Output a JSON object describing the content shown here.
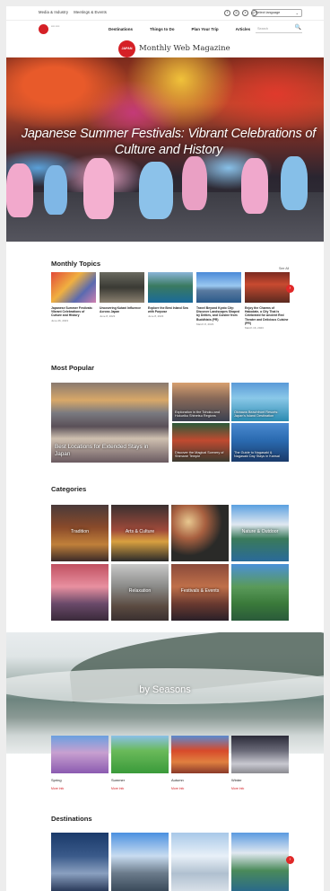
{
  "utility_bar": {
    "links": [
      "Media & Industry",
      "Meetings & Events"
    ],
    "social_icons": [
      "facebook-icon",
      "instagram-icon",
      "x-icon",
      "pinterest-icon"
    ],
    "language_select": "Select language",
    "language_caret": "⌄"
  },
  "nav": {
    "items": [
      "Destinations",
      "Things to Do",
      "Plan Your Trip",
      "Articles"
    ],
    "search_placeholder": "Search",
    "search_icon": "🔍"
  },
  "brand": {
    "mark": "JAPAN",
    "name": "Monthly Web Magazine"
  },
  "hero": {
    "title": "Japanese Summer Festivals: Vibrant Celebrations of Culture and History"
  },
  "monthly_topics": {
    "heading": "Monthly Topics",
    "see_all": "See All",
    "cards": [
      {
        "caption": "Japanese Summer Festivals: Vibrant Celebrations of Culture and History",
        "date": "June 26, 2023"
      },
      {
        "caption": "Uncovering Kutani Influence Across Japan",
        "date": "June 8, 2023"
      },
      {
        "caption": "Explore the Best Inland Sea with Purpose",
        "date": "June 8, 2023"
      },
      {
        "caption": "Travel Beyond Kyoto City: Discover Landscapes Shaped by Deities, and Cuisine from Buddhists (PR)",
        "date": "March 8, 2023"
      },
      {
        "caption": "Enjoy the Charms of Hakodate, a City That is Celebrated for Ancient Red Theater and Delicious Cuisine (PR)",
        "date": "March 16, 2023"
      }
    ]
  },
  "most_popular": {
    "heading": "Most Popular",
    "big": "Best Locations for Extended Stays in Japan",
    "small": [
      "Exploration in the Tohoku and Hokuriku Shinetsu Regions",
      "Okinawa Beachfront Resorts: Japan's Island Destination",
      "Discover the Magical Scenery of Shimane Temple",
      "The Guide to Nagasaki & Nagasaki Day Stays in Kansai"
    ]
  },
  "categories": {
    "heading": "Categories",
    "items": [
      "Tradition",
      "Arts & Culture",
      "",
      "Nature & Outdoor",
      "",
      "Relaxation",
      "Festivals & Events",
      ""
    ]
  },
  "seasons": {
    "title": "by Seasons",
    "items": [
      {
        "label": "Spring",
        "more": "More Info"
      },
      {
        "label": "Summer",
        "more": "More Info"
      },
      {
        "label": "Autumn",
        "more": "More Info"
      },
      {
        "label": "Winter",
        "more": "More Info"
      }
    ]
  },
  "destinations": {
    "heading": "Destinations"
  },
  "arrow": "›",
  "colors": {
    "accent": "#d52026",
    "arrow": "#e02828"
  }
}
